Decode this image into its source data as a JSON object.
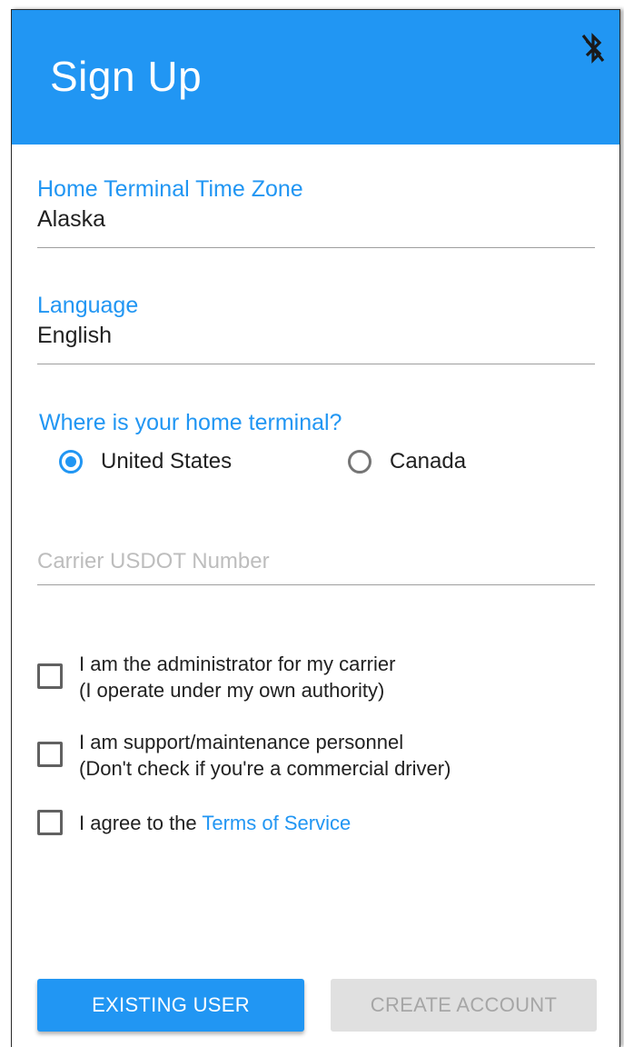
{
  "header": {
    "title": "Sign Up",
    "icon": "bluetooth-off-icon"
  },
  "form": {
    "time_zone": {
      "label": "Home Terminal Time Zone",
      "value": "Alaska"
    },
    "language": {
      "label": "Language",
      "value": "English"
    },
    "home_terminal": {
      "question": "Where is your home terminal?",
      "options": [
        {
          "label": "United States",
          "selected": true
        },
        {
          "label": "Canada",
          "selected": false
        }
      ]
    },
    "usdot": {
      "placeholder": "Carrier USDOT Number",
      "value": ""
    },
    "checkboxes": {
      "administrator": {
        "line1": "I am the administrator for my carrier",
        "line2": "(I operate under my own authority)",
        "checked": false
      },
      "support": {
        "line1": "I am support/maintenance personnel",
        "line2": "(Don't check if you're a commercial driver)",
        "checked": false
      },
      "terms": {
        "prefix": "I agree to the ",
        "link": "Terms of Service",
        "checked": false
      }
    }
  },
  "buttons": {
    "existing_user": "EXISTING USER",
    "create_account": "CREATE ACCOUNT"
  },
  "colors": {
    "accent": "#2196f3",
    "disabled_bg": "#e0e0e0",
    "disabled_text": "#a6a6a6"
  }
}
